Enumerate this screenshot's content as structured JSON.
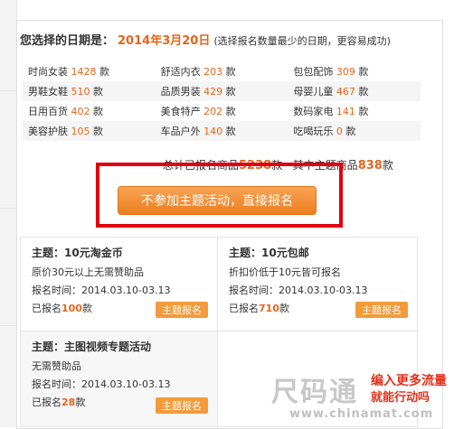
{
  "header": {
    "lead": "您选择的日期是：",
    "date": "2014年3月20日",
    "hint": "(选择报名数量最少的日期，更容易成功)"
  },
  "categories": [
    [
      {
        "name": "时尚女装",
        "count": "1428",
        "unit": "款"
      },
      {
        "name": "舒适内衣",
        "count": "203",
        "unit": "款"
      },
      {
        "name": "包包配饰",
        "count": "309",
        "unit": "款"
      }
    ],
    [
      {
        "name": "男鞋女鞋",
        "count": "510",
        "unit": "款"
      },
      {
        "name": "品质男装",
        "count": "429",
        "unit": "款"
      },
      {
        "name": "母婴儿童",
        "count": "467",
        "unit": "款"
      }
    ],
    [
      {
        "name": "日用百货",
        "count": "402",
        "unit": "款"
      },
      {
        "name": "美食特产",
        "count": "202",
        "unit": "款"
      },
      {
        "name": "数码家电",
        "count": "141",
        "unit": "款"
      }
    ],
    [
      {
        "name": "美容护肤",
        "count": "105",
        "unit": "款"
      },
      {
        "name": "车品户外",
        "count": "140",
        "unit": "款"
      },
      {
        "name": "吃喝玩乐",
        "count": "0",
        "unit": "款"
      }
    ]
  ],
  "summary": {
    "total_label": "总计已报名商品",
    "total": "5238",
    "unit1": "款",
    "theme_label": "其中主题商品",
    "theme": "838",
    "unit2": "款"
  },
  "main_button": "不参加主题活动，直接报名",
  "cards": [
    {
      "title": "主题：10元淘金币",
      "desc": "原价30元以上无需赞助品",
      "time": "报名时间：2014.03.10-03.13",
      "count_label": "已报名",
      "count": "100",
      "unit": "款",
      "action": "主题报名"
    },
    {
      "title": "主题：10元包邮",
      "desc": "折扣价低于10元皆可报名",
      "time": "报名时间：2014.03.10-03.13",
      "count_label": "已报名",
      "count": "710",
      "unit": "款",
      "action": "主题报名"
    },
    {
      "title": "主题：主图视频专题活动",
      "desc": "无需赞助品",
      "time": "报名时间：2014.03.10-03.13",
      "count_label": "已报名",
      "count": "28",
      "unit": "款",
      "action": "主题报名"
    }
  ],
  "watermark": {
    "big": "尺码通",
    "red1": "编入更多流量",
    "red2": "就能行动吗",
    "url": "www.chinamat.com"
  },
  "colors": {
    "accent": "#e8641b",
    "highlight_border": "#e00010",
    "button": "#ee7d20"
  }
}
